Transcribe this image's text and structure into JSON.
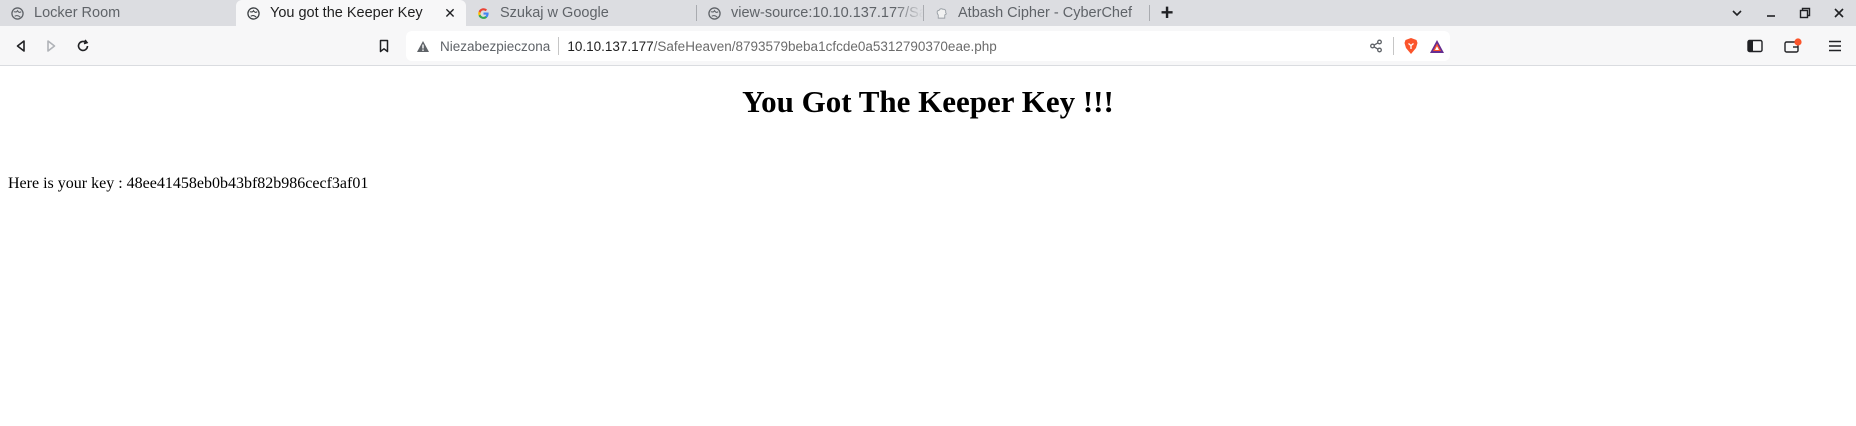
{
  "browser": {
    "tabs": [
      {
        "title": "Locker Room",
        "icon": "globe-icon",
        "active": false
      },
      {
        "title": "You got the Keeper Key",
        "icon": "globe-icon",
        "active": true
      },
      {
        "title": "Szukaj w Google",
        "icon": "google-icon",
        "active": false
      },
      {
        "title": "view-source:10.10.137.177/Safe",
        "icon": "globe-icon",
        "active": false
      },
      {
        "title": "Atbash Cipher - CyberChef",
        "icon": "cyberchef-icon",
        "active": false
      }
    ],
    "close_glyph": "✕",
    "new_tab_glyph": "+"
  },
  "addressbar": {
    "security_label": "Niezabezpieczona",
    "host": "10.10.137.177",
    "path": "/SafeHeaven/8793579beba1cfcde0a5312790370eae.php"
  },
  "page": {
    "heading": "You Got The Keeper Key !!!",
    "key_line": "Here is your key : 48ee41458eb0b43bf82b986cecf3af01"
  },
  "colors": {
    "tabstrip_bg": "#dcdde1",
    "toolbar_bg": "#f7f7f8",
    "brave_orange": "#fb542b",
    "rewards_purple": "#662d91"
  }
}
